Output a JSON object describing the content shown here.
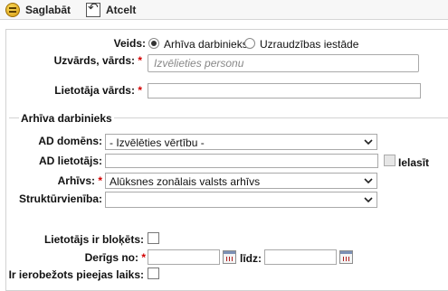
{
  "toolbar": {
    "save_label": "Saglabāt",
    "cancel_label": "Atcelt"
  },
  "form": {
    "type_label": "Veids:",
    "type_options": [
      "Arhīva darbinieks",
      "Uzraudzības iestāde"
    ],
    "name_label": "Uzvārds, vārds:",
    "name_placeholder": "Izvēlieties personu",
    "username_label": "Lietotāja vārds:",
    "required_mark": "*"
  },
  "archive_section": {
    "legend": "Arhīva darbinieks",
    "ad_domain_label": "AD domēns:",
    "ad_domain_value": "- Izvēlēties vērtību -",
    "ad_user_label": "AD lietotājs:",
    "import_label": "Ielasīt",
    "archive_label": "Arhīvs:",
    "archive_value": "Alūksnes zonālais valsts arhīvs",
    "unit_label": "Struktūrvienība:",
    "unit_value": ""
  },
  "status": {
    "blocked_label": "Lietotājs ir bloķēts:",
    "valid_from_label": "Derīgs no:",
    "until_label": "līdz:",
    "limited_time_label": "Ir ierobežots pieejas laiks:"
  },
  "colors": {
    "required": "#d20000",
    "border": "#a9a9a9",
    "toolbar_bg": "#f7f7f7"
  },
  "icons": {
    "save": "save-icon",
    "cancel": "undo-icon",
    "calendar": "calendar-icon",
    "dropdown": "chevron-down-icon"
  }
}
